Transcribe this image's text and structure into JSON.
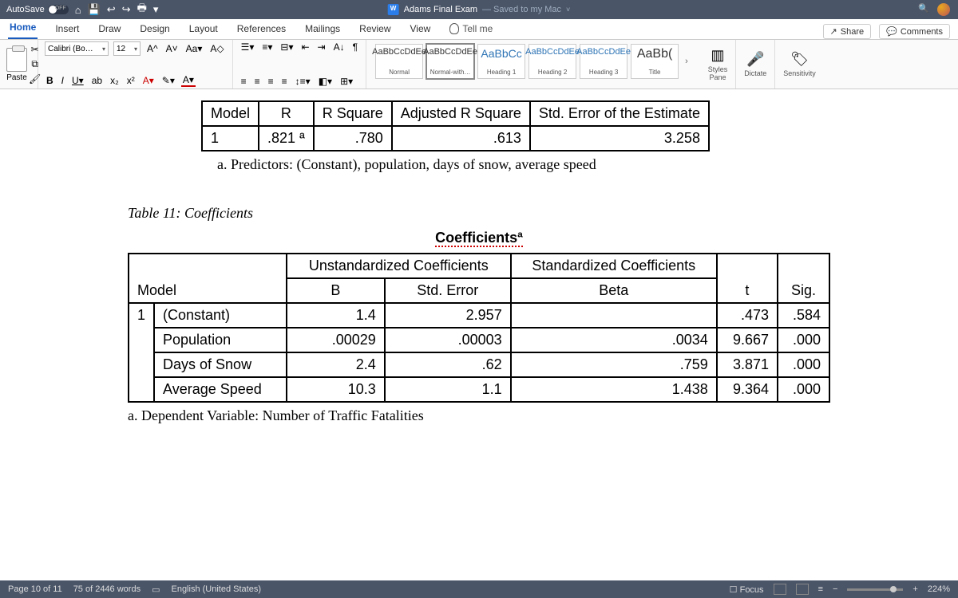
{
  "titlebar": {
    "autosave_label": "AutoSave",
    "doc_title": "Adams Final Exam",
    "saved_text": "— Saved to my Mac"
  },
  "tabs": {
    "items": [
      "Home",
      "Insert",
      "Draw",
      "Design",
      "Layout",
      "References",
      "Mailings",
      "Review",
      "View"
    ],
    "tell_me": "Tell me",
    "share": "Share",
    "comments": "Comments"
  },
  "ribbon": {
    "paste": "Paste",
    "font_name": "Calibri (Bo…",
    "font_size": "12",
    "styles": [
      {
        "preview": "AaBbCcDdEe",
        "label": "Normal"
      },
      {
        "preview": "AaBbCcDdEe",
        "label": "Normal-with…"
      },
      {
        "preview": "AaBbCc",
        "label": "Heading 1"
      },
      {
        "preview": "AaBbCcDdEe",
        "label": "Heading 2"
      },
      {
        "preview": "AaBbCcDdEe",
        "label": "Heading 3"
      },
      {
        "preview": "AaBb(",
        "label": "Title"
      }
    ],
    "styles_pane": "Styles\nPane",
    "dictate": "Dictate",
    "sensitivity": "Sensitivity"
  },
  "model_summary": {
    "headers": [
      "Model",
      "R",
      "R Square",
      "Adjusted R Square",
      "Std. Error of the Estimate"
    ],
    "row": [
      "1",
      ".821 ª",
      ".780",
      ".613",
      "3.258"
    ],
    "footnote": "a. Predictors: (Constant), population, days of snow, average speed"
  },
  "caption": "Table 11: Coefficients",
  "coef_title": "Coefficientsª",
  "coef": {
    "group_unstd": "Unstandardized Coefficients",
    "group_std": "Standardized Coefficients",
    "headers": {
      "model": "Model",
      "B": "B",
      "se": "Std. Error",
      "beta": "Beta",
      "t": "t",
      "sig": "Sig."
    },
    "rows": [
      {
        "m": "1",
        "name": "(Constant)",
        "B": "1.4",
        "se": "2.957",
        "beta": "",
        "t": ".473",
        "sig": ".584"
      },
      {
        "m": "",
        "name": "Population",
        "B": ".00029",
        "se": ".00003",
        "beta": ".0034",
        "t": "9.667",
        "sig": ".000"
      },
      {
        "m": "",
        "name": "Days of Snow",
        "B": "2.4",
        "se": ".62",
        "beta": ".759",
        "t": "3.871",
        "sig": ".000"
      },
      {
        "m": "",
        "name": "Average Speed",
        "B": "10.3",
        "se": "1.1",
        "beta": "1.438",
        "t": "9.364",
        "sig": ".000"
      }
    ],
    "footnote": "a. Dependent Variable: Number of Traffic Fatalities"
  },
  "status": {
    "page": "Page 10 of 11",
    "words": "75 of 2446 words",
    "lang": "English (United States)",
    "focus": "Focus",
    "zoom": "224%"
  }
}
